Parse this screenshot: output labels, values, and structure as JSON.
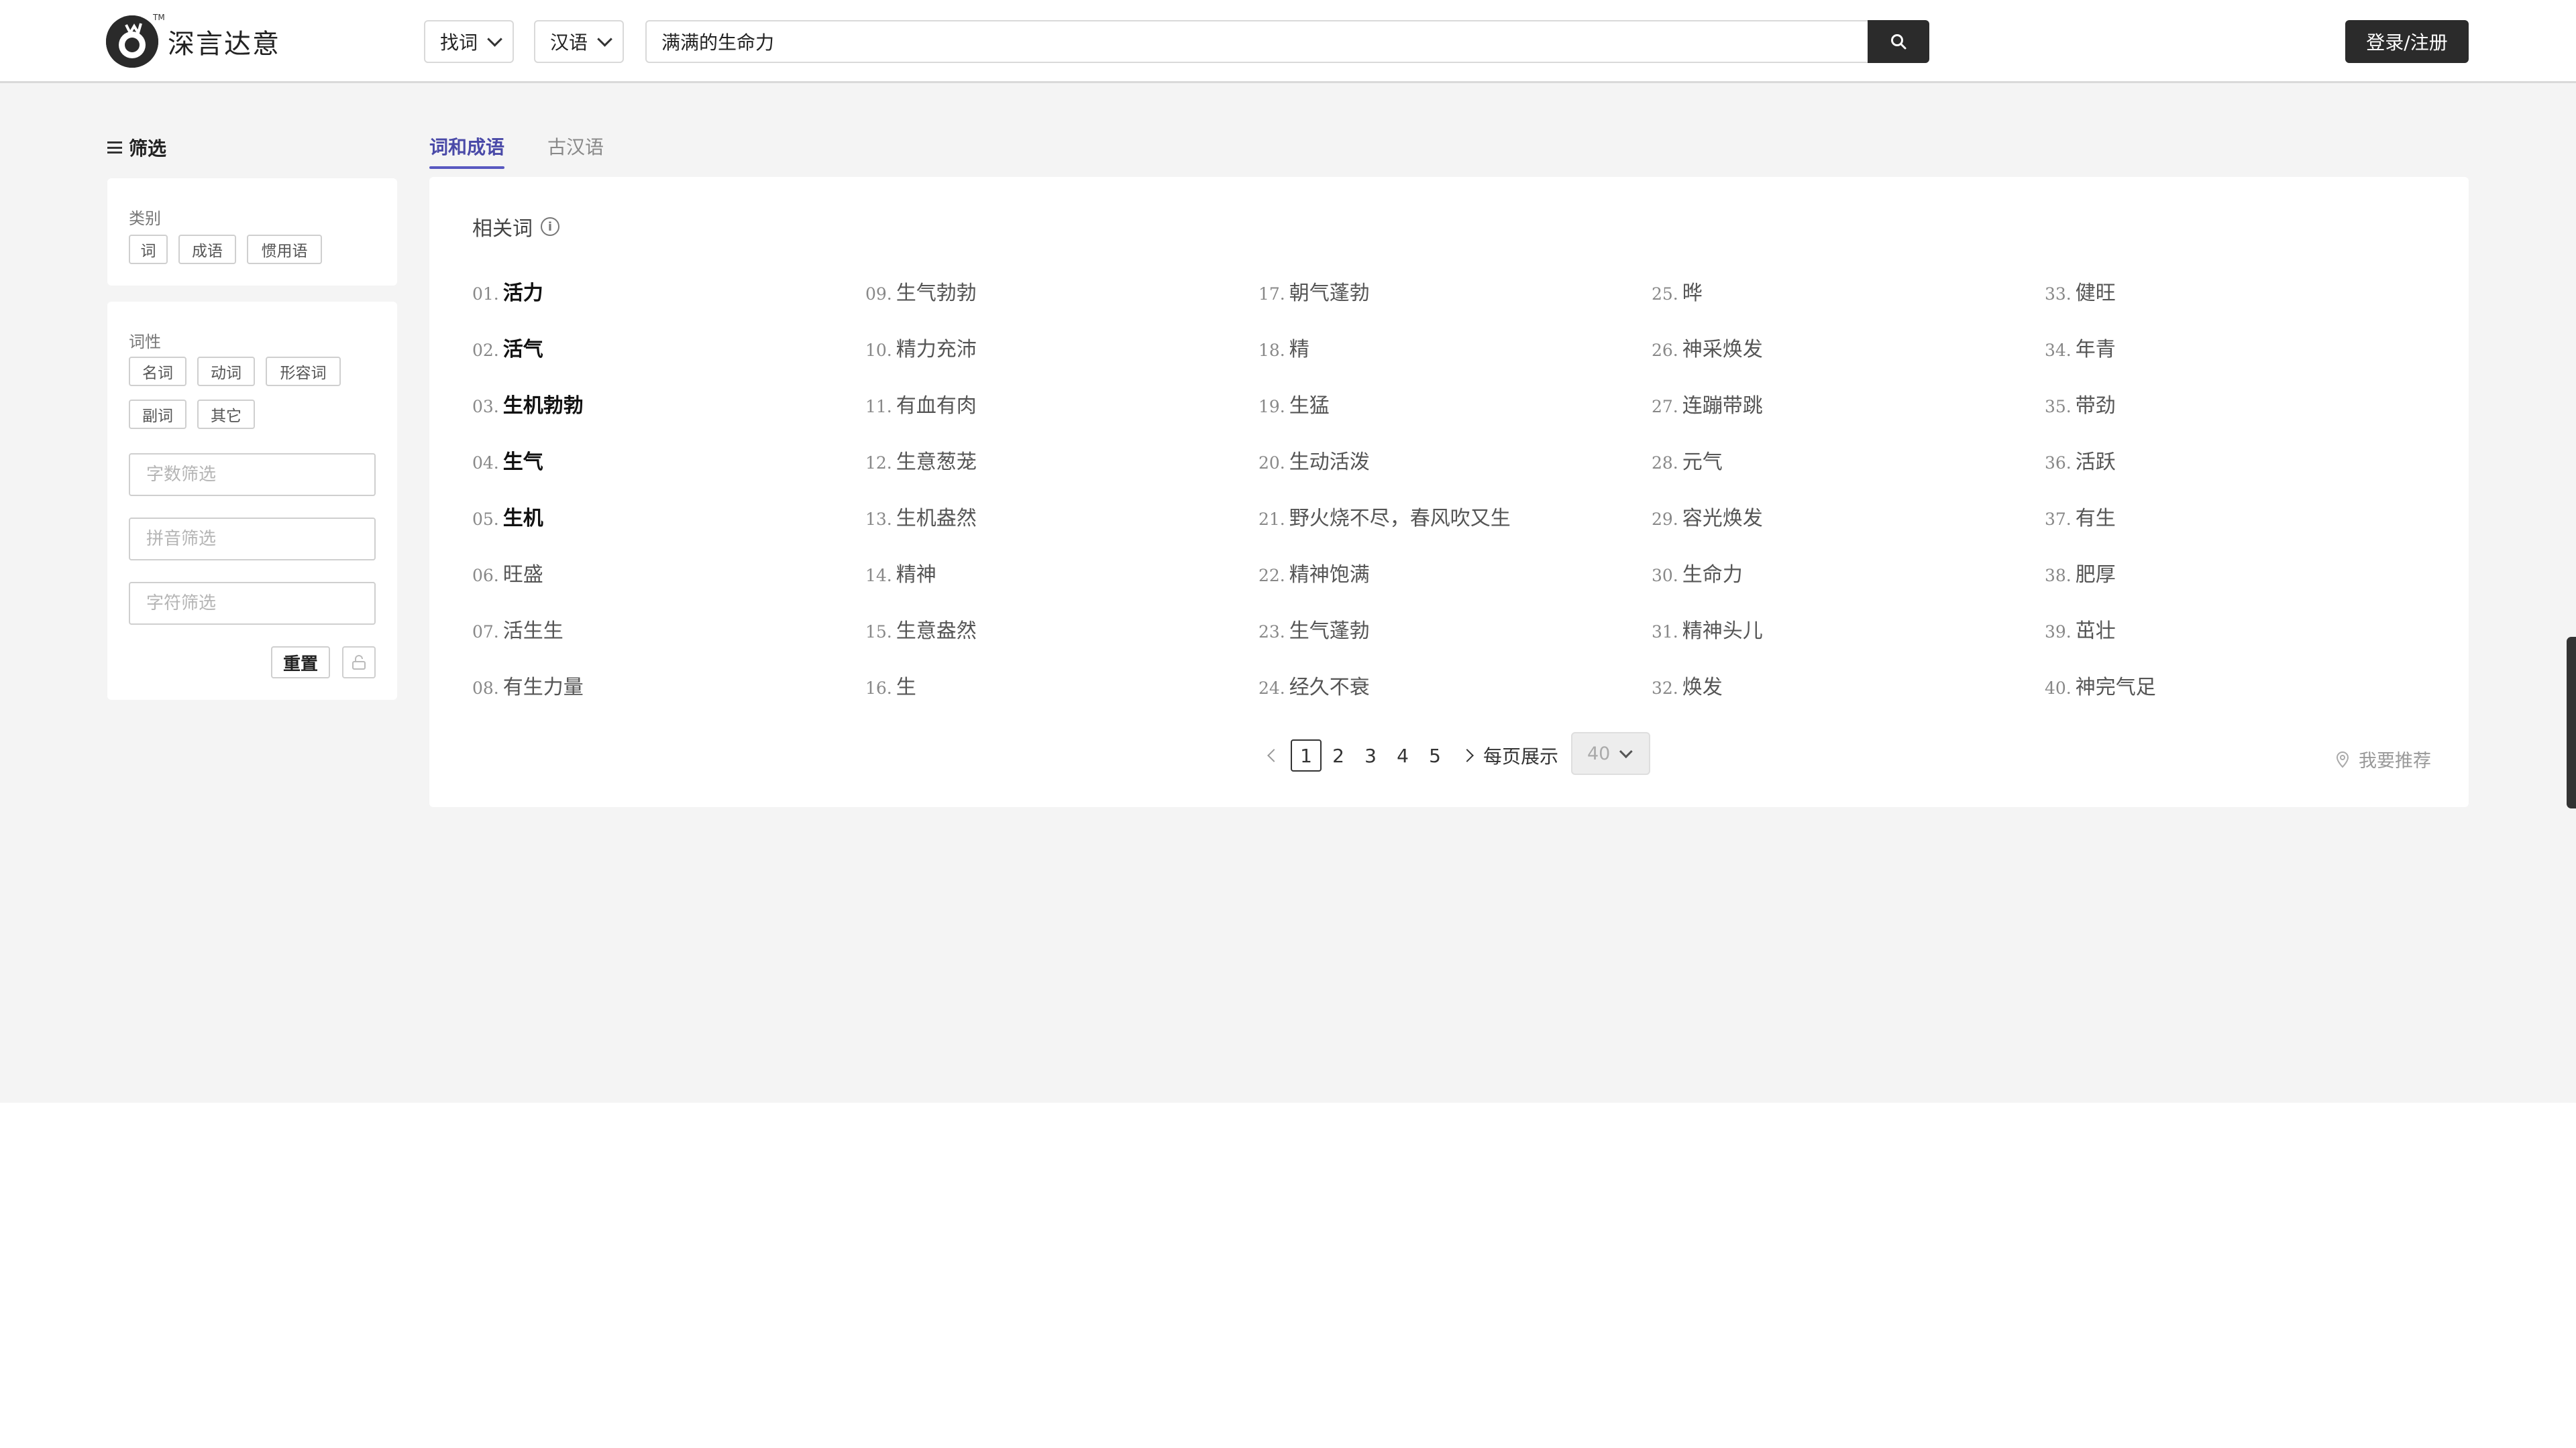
{
  "header": {
    "logo_text": "深言达意",
    "logo_tm": "TM",
    "mode_select": "找词",
    "lang_select": "汉语",
    "search_query": "满满的生命力",
    "login_label": "登录/注册"
  },
  "sidebar": {
    "title": "筛选",
    "category": {
      "label": "类别",
      "chips": [
        "词",
        "成语",
        "惯用语"
      ]
    },
    "pos": {
      "label": "词性",
      "chips": [
        "名词",
        "动词",
        "形容词",
        "副词",
        "其它"
      ]
    },
    "inputs": {
      "char_count_placeholder": "字数筛选",
      "pinyin_placeholder": "拼音筛选",
      "char_placeholder": "字符筛选"
    },
    "reset_label": "重置"
  },
  "tabs": [
    {
      "label": "词和成语",
      "active": true
    },
    {
      "label": "古汉语",
      "active": false
    }
  ],
  "results": {
    "section_title": "相关词",
    "info_symbol": "i",
    "columns": [
      [
        {
          "num": "01.",
          "word": "活力",
          "bold": true
        },
        {
          "num": "02.",
          "word": "活气",
          "bold": true
        },
        {
          "num": "03.",
          "word": "生机勃勃",
          "bold": true
        },
        {
          "num": "04.",
          "word": "生气",
          "bold": true
        },
        {
          "num": "05.",
          "word": "生机",
          "bold": true
        },
        {
          "num": "06.",
          "word": "旺盛",
          "bold": false
        },
        {
          "num": "07.",
          "word": "活生生",
          "bold": false
        },
        {
          "num": "08.",
          "word": "有生力量",
          "bold": false
        }
      ],
      [
        {
          "num": "09.",
          "word": "生气勃勃",
          "bold": false
        },
        {
          "num": "10.",
          "word": "精力充沛",
          "bold": false
        },
        {
          "num": "11.",
          "word": "有血有肉",
          "bold": false
        },
        {
          "num": "12.",
          "word": "生意葱茏",
          "bold": false
        },
        {
          "num": "13.",
          "word": "生机盎然",
          "bold": false
        },
        {
          "num": "14.",
          "word": "精神",
          "bold": false
        },
        {
          "num": "15.",
          "word": "生意盎然",
          "bold": false
        },
        {
          "num": "16.",
          "word": "生",
          "bold": false
        }
      ],
      [
        {
          "num": "17.",
          "word": "朝气蓬勃",
          "bold": false
        },
        {
          "num": "18.",
          "word": "精",
          "bold": false
        },
        {
          "num": "19.",
          "word": "生猛",
          "bold": false
        },
        {
          "num": "20.",
          "word": "生动活泼",
          "bold": false
        },
        {
          "num": "21.",
          "word": "野火烧不尽，春风吹又生",
          "bold": false
        },
        {
          "num": "22.",
          "word": "精神饱满",
          "bold": false
        },
        {
          "num": "23.",
          "word": "生气蓬勃",
          "bold": false
        },
        {
          "num": "24.",
          "word": "经久不衰",
          "bold": false
        }
      ],
      [
        {
          "num": "25.",
          "word": "晔",
          "bold": false
        },
        {
          "num": "26.",
          "word": "神采焕发",
          "bold": false
        },
        {
          "num": "27.",
          "word": "连蹦带跳",
          "bold": false
        },
        {
          "num": "28.",
          "word": "元气",
          "bold": false
        },
        {
          "num": "29.",
          "word": "容光焕发",
          "bold": false
        },
        {
          "num": "30.",
          "word": "生命力",
          "bold": false
        },
        {
          "num": "31.",
          "word": "精神头儿",
          "bold": false
        },
        {
          "num": "32.",
          "word": "焕发",
          "bold": false
        }
      ],
      [
        {
          "num": "33.",
          "word": "健旺",
          "bold": false
        },
        {
          "num": "34.",
          "word": "年青",
          "bold": false
        },
        {
          "num": "35.",
          "word": "带劲",
          "bold": false
        },
        {
          "num": "36.",
          "word": "活跃",
          "bold": false
        },
        {
          "num": "37.",
          "word": "有生",
          "bold": false
        },
        {
          "num": "38.",
          "word": "肥厚",
          "bold": false
        },
        {
          "num": "39.",
          "word": "茁壮",
          "bold": false
        },
        {
          "num": "40.",
          "word": "神完气足",
          "bold": false
        }
      ]
    ]
  },
  "pagination": {
    "pages": [
      "1",
      "2",
      "3",
      "4",
      "5"
    ],
    "current": "1",
    "per_page_label": "每页展示",
    "per_page_value": "40"
  },
  "recommend_label": "我要推荐",
  "colors": {
    "accent": "#5858c0",
    "dark": "#2b2b2b",
    "background": "#f4f4f4"
  }
}
